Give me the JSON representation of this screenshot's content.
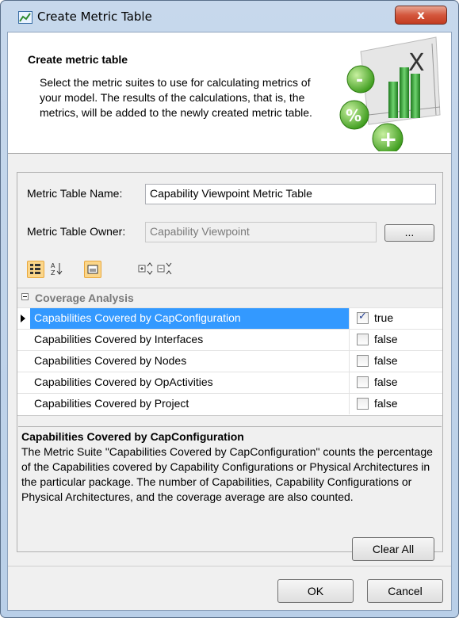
{
  "window": {
    "title": "Create Metric Table",
    "close_label": "x"
  },
  "banner": {
    "title": "Create metric table",
    "description": "Select the metric suites to use for calculating metrics of your model. The results of the calculations, that is, the metrics, will be added to the newly created metric table.",
    "graphic_glyphs": [
      "-",
      "%",
      "+",
      "X"
    ]
  },
  "form": {
    "name_label": "Metric Table Name:",
    "name_value": "Capability Viewpoint Metric Table",
    "owner_label": "Metric Table Owner:",
    "owner_value": "Capability Viewpoint",
    "browse_label": "...",
    "toolbar_icons": [
      "categorized-view-icon",
      "sort-alphabetically-icon",
      "show-description-icon",
      "expand-all-icon",
      "collapse-all-icon"
    ]
  },
  "grid": {
    "category": "Coverage Analysis",
    "rows": [
      {
        "name": "Capabilities Covered by CapConfiguration",
        "checked": true,
        "value": "true"
      },
      {
        "name": "Capabilities Covered by Interfaces",
        "checked": false,
        "value": "false"
      },
      {
        "name": "Capabilities Covered by Nodes",
        "checked": false,
        "value": "false"
      },
      {
        "name": "Capabilities Covered by OpActivities",
        "checked": false,
        "value": "false"
      },
      {
        "name": "Capabilities Covered by Project",
        "checked": false,
        "value": "false"
      }
    ]
  },
  "description": {
    "title": "Capabilities Covered by CapConfiguration",
    "text": "The Metric Suite \"Capabilities Covered by CapConfiguration\" counts the percentage of the Capabilities covered by Capability Configurations or Physical Architectures in the particular package. The number of Capabilities, Capability Configurations or Physical Architectures, and the coverage average are also counted."
  },
  "buttons": {
    "clear_all": "Clear All",
    "ok": "OK",
    "cancel": "Cancel"
  },
  "colors": {
    "selection": "#3399ff",
    "title_bar": "#c7d8ec",
    "close_button": "#c23b20",
    "toolbar_active": "#fbd68a"
  }
}
